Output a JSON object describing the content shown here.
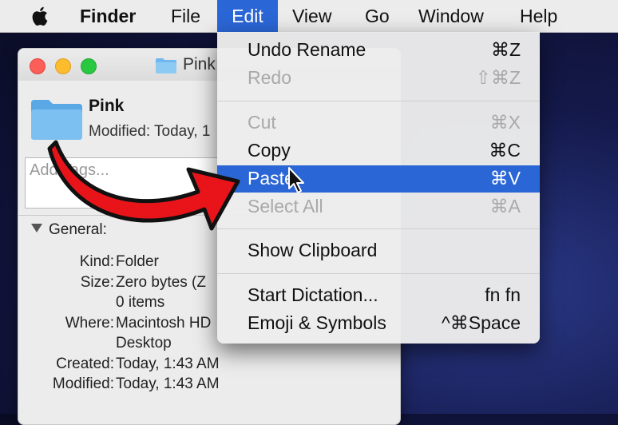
{
  "menubar": {
    "app": "Finder",
    "items": [
      "File",
      "Edit",
      "View",
      "Go",
      "Window",
      "Help"
    ],
    "active": "Edit"
  },
  "window": {
    "title": "Pink",
    "file_name": "Pink",
    "modified_line": "Modified: Today, 1",
    "tags_placeholder": "Add Tags...",
    "section": "General:",
    "info": [
      {
        "label": "Kind:",
        "value": "Folder"
      },
      {
        "label": "Size:",
        "value": "Zero bytes (Z"
      },
      {
        "label": "",
        "value": "0 items"
      },
      {
        "label": "Where:",
        "value": "Macintosh HD"
      },
      {
        "label": "",
        "value": "Desktop"
      },
      {
        "label": "Created:",
        "value": "Today, 1:43 AM"
      },
      {
        "label": "Modified:",
        "value": "Today, 1:43 AM"
      }
    ]
  },
  "edit_menu": {
    "items": [
      {
        "label": "Undo Rename",
        "shortcut": "⌘Z",
        "enabled": true
      },
      {
        "label": "Redo",
        "shortcut": "⇧⌘Z",
        "enabled": false
      },
      {
        "label": "Cut",
        "shortcut": "⌘X",
        "enabled": false
      },
      {
        "label": "Copy",
        "shortcut": "⌘C",
        "enabled": true
      },
      {
        "label": "Paste",
        "shortcut": "⌘V",
        "enabled": true,
        "highlighted": true
      },
      {
        "label": "Select All",
        "shortcut": "⌘A",
        "enabled": false
      },
      {
        "label": "Show Clipboard",
        "shortcut": "",
        "enabled": true
      },
      {
        "label": "Start Dictation...",
        "shortcut": "fn fn",
        "enabled": true
      },
      {
        "label": "Emoji & Symbols",
        "shortcut": "^⌘Space",
        "enabled": true
      }
    ]
  },
  "colors": {
    "highlight": "#2b66d6",
    "arrow": "#e8141a",
    "folder": "#6fb8ef"
  }
}
